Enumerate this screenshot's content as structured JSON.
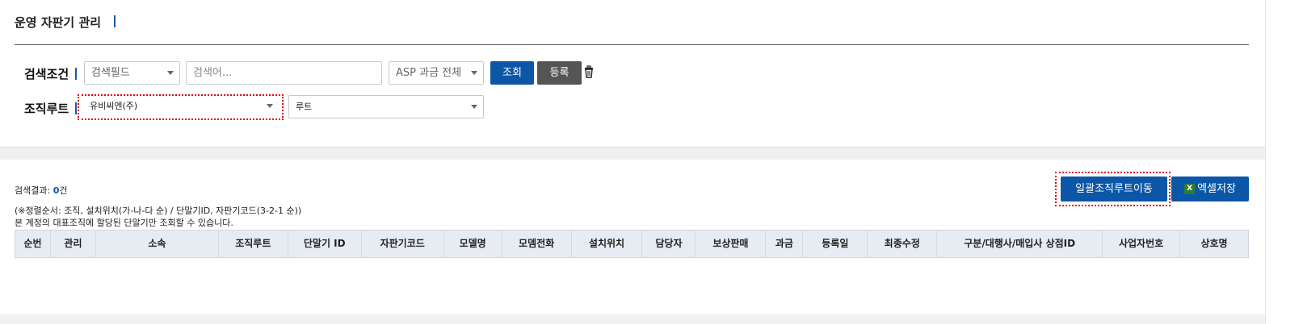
{
  "page": {
    "title": "운영 자판기 관리"
  },
  "search": {
    "label": "검색조건",
    "field_select": "검색필드",
    "keyword_placeholder": "검색어...",
    "asp_select": "ASP 과금 전체",
    "query_button": "조회",
    "register_button": "등록"
  },
  "org_route": {
    "label": "조직루트",
    "org_select": "유비씨엔(주)",
    "route_select": "루트"
  },
  "results": {
    "prefix": "검색결과:",
    "count": "0",
    "suffix": "건",
    "sort_note": "(※정렬순서: 조직, 설치위치(가-나-다 순) / 단말기ID, 자판기코드(3-2-1 순))",
    "scope_note": "본 계정의 대표조직에 할당된 단말기만 조회할 수 있습니다.",
    "bulk_move_button": "일괄조직루트이동",
    "excel_button": "엑셀저장"
  },
  "table": {
    "columns": [
      "순번",
      "관리",
      "소속",
      "조직루트",
      "단말기 ID",
      "자판기코드",
      "모델명",
      "모뎀전화",
      "설치위치",
      "담당자",
      "보상판매",
      "과금",
      "등록일",
      "최종수정",
      "구분/대행사/매입사 상점ID",
      "사업자번호",
      "상호명"
    ]
  },
  "icons": {
    "trash": "trash-icon",
    "excel": "excel-icon"
  },
  "colors": {
    "accent": "#0b56a6",
    "dark_button": "#555555",
    "highlight": "#e00000",
    "header_bg": "#e7ecf3"
  }
}
